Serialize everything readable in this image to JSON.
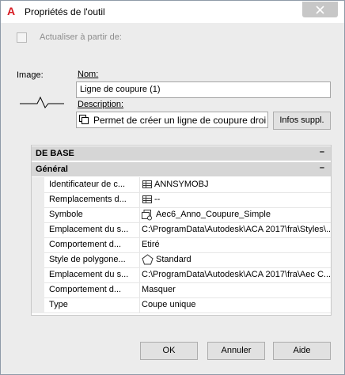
{
  "window": {
    "title": "Propriétés de l'outil",
    "app_icon": "A"
  },
  "update_from": {
    "label": "Actualiser à partir de:",
    "checked": false
  },
  "image": {
    "label": "Image:"
  },
  "name": {
    "label": "Nom:",
    "value": "Ligne de coupure (1)"
  },
  "description": {
    "label": "Description:",
    "value": "Permet de créer un ligne de coupure droi",
    "more_button": "Infos suppl."
  },
  "properties": {
    "cat_base": "DE BASE",
    "cat_general": "Général",
    "collapse_symbol": "–",
    "rows": [
      {
        "key": "Identificateur de c...",
        "value": "ANNSYMOBJ",
        "icon": "table-icon"
      },
      {
        "key": "Remplacements d...",
        "value": "--",
        "icon": "table-icon"
      },
      {
        "key": "Symbole",
        "value": "Aec6_Anno_Coupure_Simple",
        "icon": "symbol-icon"
      },
      {
        "key": "Emplacement du s...",
        "value": "C:\\ProgramData\\Autodesk\\ACA 2017\\fra\\Styles\\...",
        "icon": ""
      },
      {
        "key": "Comportement d...",
        "value": "Etiré",
        "icon": ""
      },
      {
        "key": "Style de polygone...",
        "value": "Standard",
        "icon": "pentagon-icon"
      },
      {
        "key": "Emplacement du s...",
        "value": "C:\\ProgramData\\Autodesk\\ACA 2017\\fra\\Aec C...",
        "icon": ""
      },
      {
        "key": "Comportement d...",
        "value": "Masquer",
        "icon": ""
      },
      {
        "key": "Type",
        "value": "Coupe unique",
        "icon": ""
      }
    ]
  },
  "buttons": {
    "ok": "OK",
    "cancel": "Annuler",
    "help": "Aide"
  }
}
